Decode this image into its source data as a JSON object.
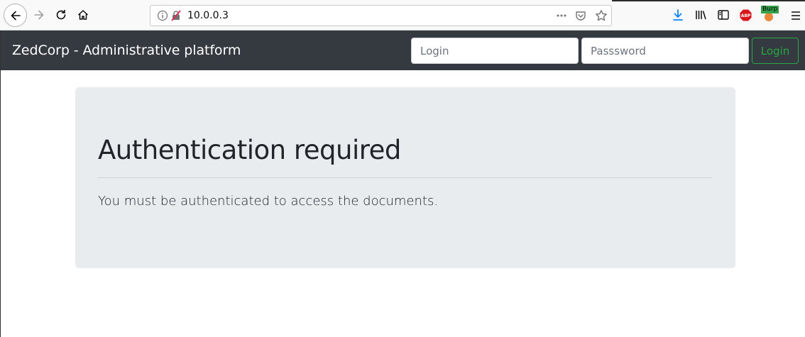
{
  "browser": {
    "url": "10.0.0.3",
    "extensions": {
      "abp_label": "ABP",
      "burp_label": "Burp"
    }
  },
  "navbar": {
    "brand": "ZedCorp - Administrative platform",
    "login_placeholder": "Login",
    "password_placeholder": "Passsword",
    "login_button": "Login"
  },
  "main": {
    "title": "Authentication required",
    "message": "You must be authenticated to access the documents."
  },
  "colors": {
    "navbar_bg": "#343a40",
    "jumbotron_bg": "#e9ecef",
    "success": "#28a745"
  }
}
